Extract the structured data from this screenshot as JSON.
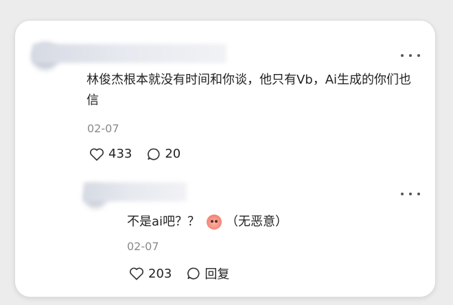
{
  "comment": {
    "text": "林俊杰根本就没有时间和你谈，他只有Vb，Ai生成的你们也信",
    "date": "02-07",
    "likes": "433",
    "replies": "20"
  },
  "reply": {
    "text_before": "不是ai吧？？",
    "text_after": "（无恶意）",
    "date": "02-07",
    "likes": "203",
    "reply_label": "回复"
  }
}
